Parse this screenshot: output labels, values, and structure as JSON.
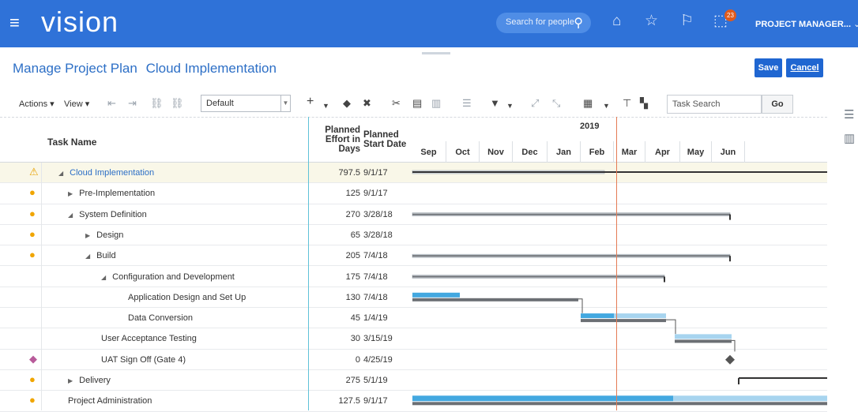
{
  "header": {
    "app_name": "vision",
    "search_placeholder": "Search for people",
    "notification_count": "23",
    "user_label": "PROJECT MANAGER...",
    "icons": [
      "menu-icon",
      "search-icon",
      "home-icon",
      "star-icon",
      "flag-icon",
      "notifications-icon",
      "chevron-down-icon"
    ]
  },
  "page": {
    "title": "Manage Project Plan",
    "project": "Cloud Implementation",
    "save_label": "Save",
    "cancel_label": "Cancel"
  },
  "toolbar": {
    "actions_label": "Actions",
    "view_label": "View",
    "view_select": "Default",
    "task_search_placeholder": "Task Search",
    "go_label": "Go"
  },
  "columns": {
    "task_name": "Task Name",
    "effort": "Planned Effort in Days",
    "effort_lines": [
      "Planned",
      "Effort in",
      "Days"
    ],
    "start": "Planned Start Date",
    "start_lines": [
      "Planned",
      "Start Date"
    ]
  },
  "timeline": {
    "year": "2019",
    "months": [
      "Sep",
      "Oct",
      "Nov",
      "Dec",
      "Jan",
      "Feb",
      "Mar",
      "Apr",
      "May",
      "Jun"
    ]
  },
  "rows": [
    {
      "name": "Cloud Implementation",
      "effort": "797.5",
      "start": "9/1/17",
      "status": "warning",
      "level": 0,
      "toggle": "expanded",
      "link": true
    },
    {
      "name": "Pre-Implementation",
      "effort": "125",
      "start": "9/1/17",
      "status": "coins",
      "level": 1,
      "toggle": "collapsed"
    },
    {
      "name": "System Definition",
      "effort": "270",
      "start": "3/28/18",
      "status": "coins",
      "level": 1,
      "toggle": "expanded"
    },
    {
      "name": "Design",
      "effort": "65",
      "start": "3/28/18",
      "status": "coins",
      "level": 2,
      "toggle": "collapsed"
    },
    {
      "name": "Build",
      "effort": "205",
      "start": "7/4/18",
      "status": "coins",
      "level": 2,
      "toggle": "expanded"
    },
    {
      "name": "Configuration and Development",
      "effort": "175",
      "start": "7/4/18",
      "status": "",
      "level": 3,
      "toggle": "expanded"
    },
    {
      "name": "Application Design and Set Up",
      "effort": "130",
      "start": "7/4/18",
      "status": "",
      "level": 4,
      "toggle": ""
    },
    {
      "name": "Data Conversion",
      "effort": "45",
      "start": "1/4/19",
      "status": "",
      "level": 4,
      "toggle": ""
    },
    {
      "name": "User Acceptance Testing",
      "effort": "30",
      "start": "3/15/19",
      "status": "",
      "level": 3,
      "toggle": ""
    },
    {
      "name": "UAT Sign Off (Gate 4)",
      "effort": "0",
      "start": "4/25/19",
      "status": "milestone",
      "level": 3,
      "toggle": ""
    },
    {
      "name": "Delivery",
      "effort": "275",
      "start": "5/1/19",
      "status": "coins",
      "level": 1,
      "toggle": "collapsed"
    },
    {
      "name": "Project Administration",
      "effort": "127.5",
      "start": "9/1/17",
      "status": "coins",
      "level": 1,
      "toggle": ""
    }
  ],
  "colors": {
    "brand": "#2f72d8",
    "link": "#2d6fc6",
    "today_line": "#e57c55",
    "bar_actual": "#43a8e0",
    "bar_planned": "#a7d4ef",
    "baseline": "#6b6f74"
  }
}
